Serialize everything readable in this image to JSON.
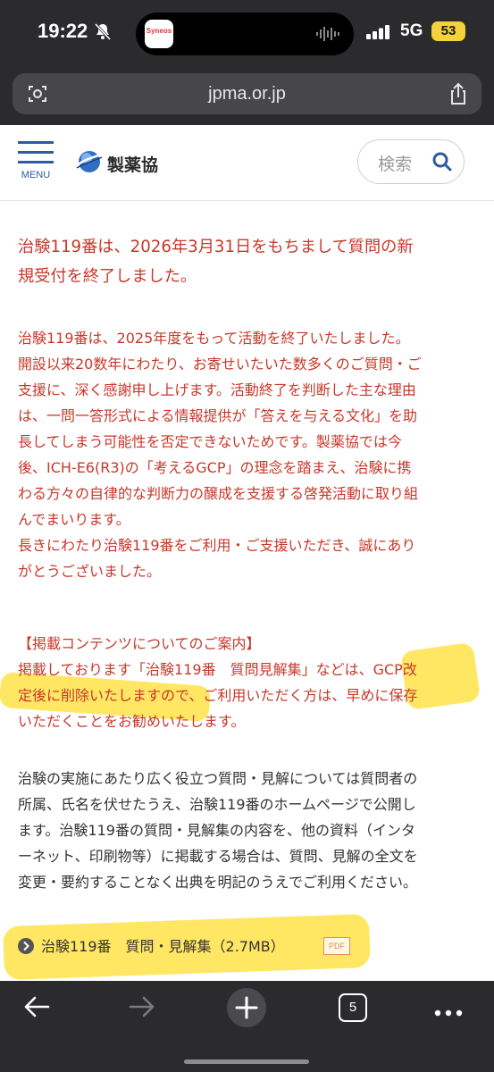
{
  "status_bar": {
    "time": "19:22",
    "island_app_label": "Syneos",
    "network": "5G",
    "battery": "53",
    "icons": [
      "bell-slash-icon",
      "waveform-icon",
      "signal-icon"
    ]
  },
  "browser": {
    "url": "jpma.or.jp",
    "icons": [
      "reader-icon",
      "share-icon"
    ]
  },
  "header": {
    "menu_label": "MENU",
    "logo_text": "製薬協",
    "search_placeholder": "検索",
    "brand_color": "#2d5aa0"
  },
  "notice": {
    "title_lines": [
      "治験119番は、2026年3月31日をもちまして質問の新",
      "規受付を終了しました。"
    ],
    "body_lines": [
      "治験119番は、2025年度をもって活動を終了いたしました。",
      "開設以来20数年にわたり、お寄せいたいた数多くのご質問・ご",
      "支援に、深く感謝申し上げます。活動終了を判断した主な理由",
      "は、一問一答形式による情報提供が「答えを与える文化」を助",
      "長してしまう可能性を否定できないためです。製薬協では今",
      "後、ICH-E6(R3)の「考えるGCP」の理念を踏まえ、治験に携",
      "わる方々の自律的な判断力の醸成を支援する啓発活動に取り組",
      "んでまいります。",
      "長きにわたり治験119番をご利用・ご支援いただき、誠にあり",
      "がとうございました。"
    ],
    "color": "#c8382a"
  },
  "guide": {
    "heading": "【掲載コンテンツについてのご案内】",
    "lines": [
      "掲載しております「治験119番　質問見解集」などは、GCP改",
      "定後に削除いたしますので、ご利用いただく方は、早めに保存",
      "いただくことをお勧めいたします。"
    ]
  },
  "publish": {
    "lines": [
      "治験の実施にあたり広く役立つ質問・見解については質問者の",
      "所属、氏名を伏せたうえ、治験119番のホームページで公開し",
      "ます。治験119番の質問・見解集の内容を、他の資料（インタ",
      "ーネット、印刷物等）に掲載する場合は、質問、見解の全文を",
      "変更・要約することなく出典を明記のうえでご利用ください。"
    ]
  },
  "download": {
    "link_text": "治験119番　質問・見解集（2.7MB）",
    "badge": "PDF"
  },
  "highlight_color": "#ffde28",
  "toolbar": {
    "tab_count": "5",
    "icons": [
      "back-arrow-icon",
      "forward-arrow-icon",
      "plus-icon",
      "tabs-icon",
      "more-icon"
    ]
  }
}
